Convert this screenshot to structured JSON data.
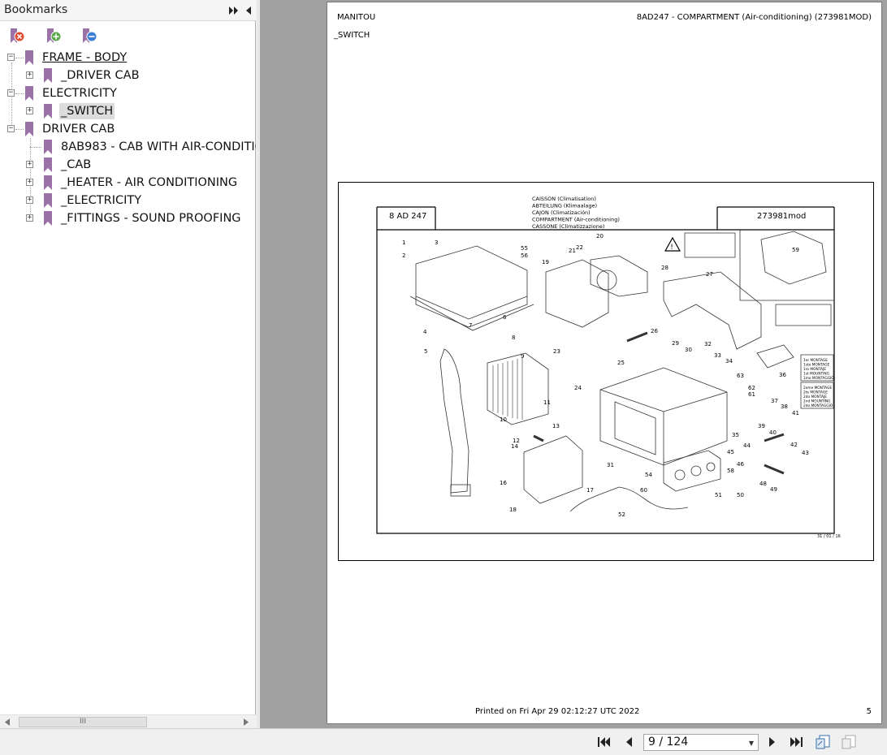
{
  "bookmarks_panel": {
    "title": "Bookmarks",
    "toolbar_icons": [
      "delete-bookmark-icon",
      "expand-bookmark-icon",
      "collapse-bookmark-icon"
    ],
    "tree": [
      {
        "label": "FRAME - BODY",
        "expanded": true,
        "children": [
          {
            "label": "_DRIVER CAB",
            "expanded": false
          }
        ]
      },
      {
        "label": "ELECTRICITY",
        "expanded": true,
        "children": [
          {
            "label": "_SWITCH",
            "expanded": false,
            "selected": true
          }
        ]
      },
      {
        "label": "DRIVER CAB",
        "expanded": true,
        "children": [
          {
            "label": "8AB983 - CAB WITH AIR-CONDITIO",
            "leaf": true
          },
          {
            "label": "_CAB",
            "expanded": false
          },
          {
            "label": "_HEATER - AIR CONDITIONING",
            "expanded": false
          },
          {
            "label": "_ELECTRICITY",
            "expanded": false
          },
          {
            "label": "_FITTINGS - SOUND PROOFING",
            "expanded": false
          }
        ]
      }
    ],
    "scroll_thumb": "III"
  },
  "page": {
    "header_left": "MANITOU",
    "header_right": "8AD247 - COMPARTMENT (Air-conditioning) (273981MOD)",
    "subtitle": "_SWITCH",
    "figure": {
      "ref_left": "8 AD 247",
      "ref_right": "273981mod",
      "titles": [
        "CAISSON (Climatisation)",
        "ABTEILUNG (Klimaalage)",
        "CAJON (Climatización)",
        "COMPARTMENT (Air-conditioning)",
        "CASSONE (Climatizzazione)"
      ],
      "legend1": [
        "1er MONTAGE",
        "1ste MONTAGE",
        "1ro MONTAJE",
        "1st MOUNTING",
        "1mo MONTAGGIO"
      ],
      "legend2": [
        "2eme MONTAGE",
        "2te MONTAGE",
        "2do MONTAJE",
        "2nd MOUNTING",
        "2do MONTAGGIO"
      ],
      "date": "31 / 01 / 16",
      "part_numbers": [
        "1",
        "2",
        "3",
        "4",
        "5",
        "6",
        "7",
        "8",
        "9",
        "10",
        "11",
        "12",
        "13",
        "14",
        "16",
        "17",
        "18",
        "19",
        "20",
        "21",
        "22",
        "23",
        "24",
        "25",
        "26",
        "27",
        "28",
        "29",
        "30",
        "31",
        "32",
        "33",
        "34",
        "35",
        "36",
        "37",
        "38",
        "39",
        "40",
        "41",
        "42",
        "43",
        "44",
        "45",
        "46",
        "48",
        "49",
        "50",
        "51",
        "52",
        "54",
        "55",
        "56",
        "58",
        "59",
        "60",
        "61",
        "62",
        "63"
      ]
    },
    "footer_printed": "Printed on  Fri Apr 29 02:12:27 UTC 2022",
    "footer_page": "5"
  },
  "navigation": {
    "current_page": "9 / 124",
    "buttons": [
      "first-page",
      "previous-page",
      "next-page",
      "last-page",
      "fit-page",
      "fit-width"
    ]
  },
  "colors": {
    "bookmark": "#9b72a8",
    "panel_bg": "#ffffff",
    "doc_bg": "#a0a0a0",
    "selected": "#dcdcdc"
  }
}
